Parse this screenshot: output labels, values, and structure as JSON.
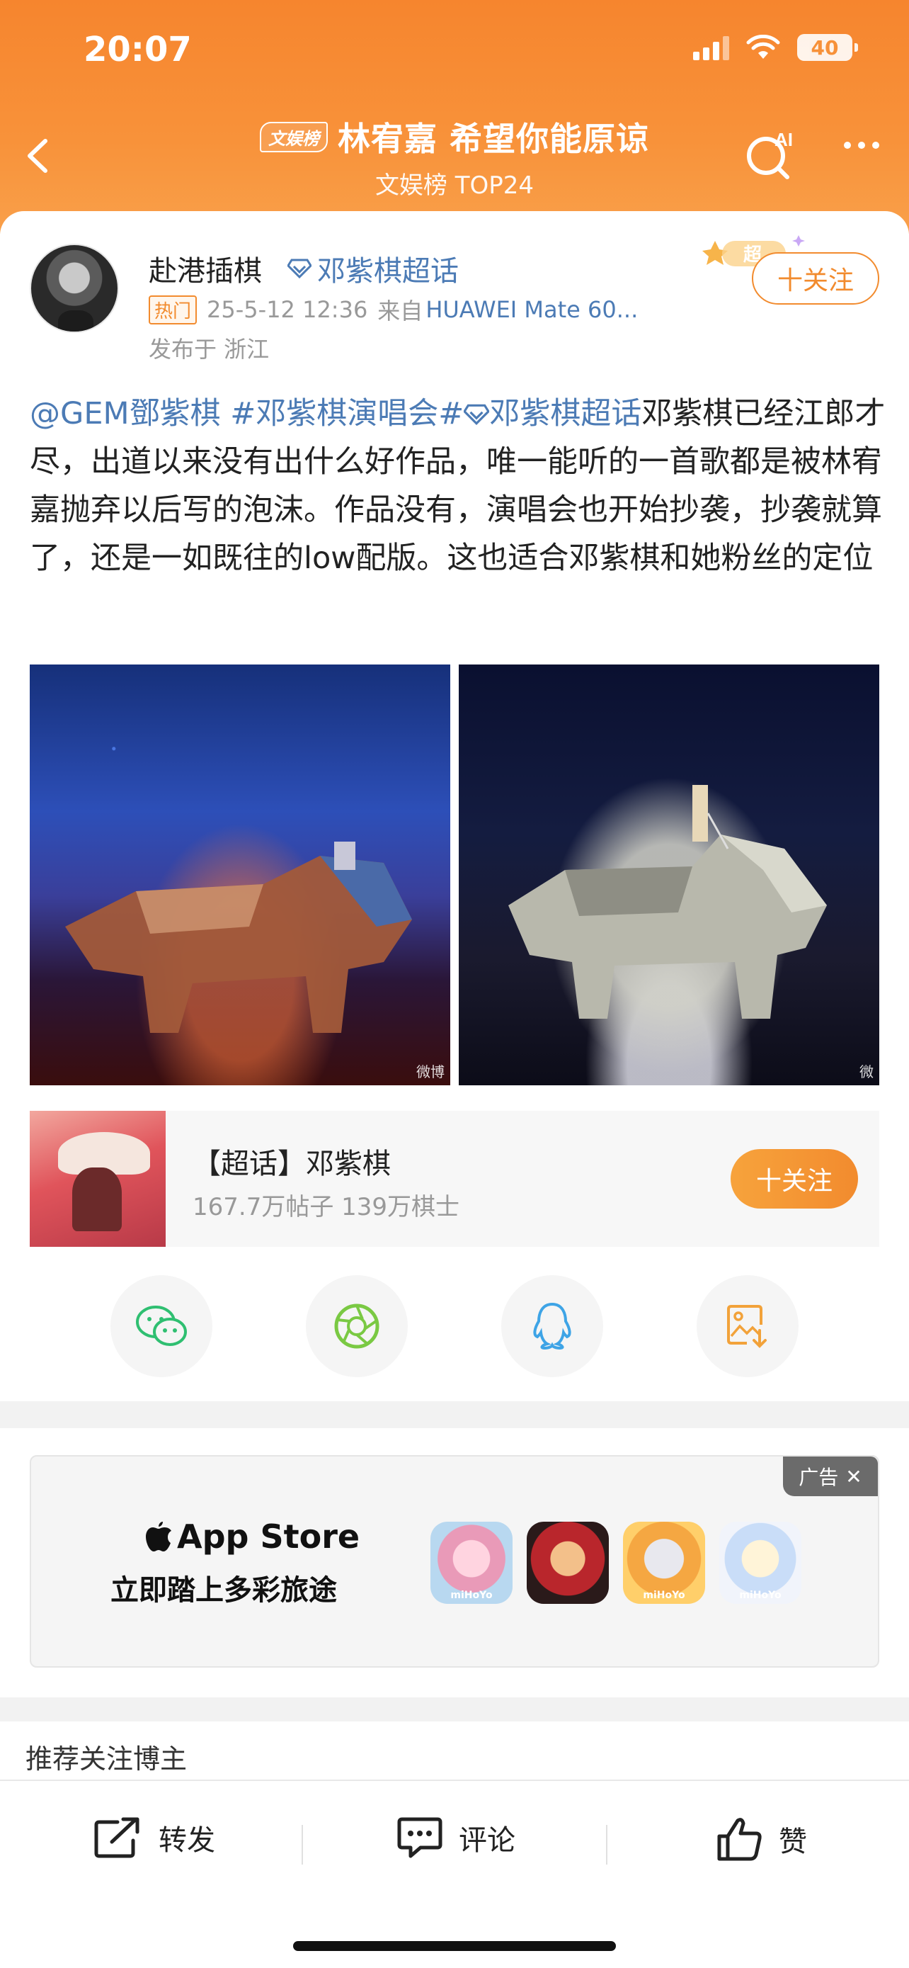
{
  "status": {
    "time": "20:07",
    "battery": "40"
  },
  "header": {
    "tag": "文娱榜",
    "title": "林宥嘉 希望你能原谅",
    "subtitle": "文娱榜 TOP24",
    "ai_label": "AI"
  },
  "post": {
    "username": "赴港插棋",
    "super_topic_link": "邓紫棋超话",
    "hot_badge": "热门",
    "datetime": "25-5-12 12:36",
    "source_prefix": "来自",
    "device": "HUAWEI Mate 60...",
    "location": "发布于 浙江",
    "follow_label": "十关注",
    "deco_label": "超",
    "text_mention": "@GEM鄧紫棋",
    "text_tag1": "#邓紫棋演唱会#",
    "text_tag2": "邓紫棋超话",
    "text_body": "邓紫棋已经江郎才尽，出道以来没有出什么好作品，唯一能听的一首歌都是被林宥嘉抛弃以后写的泡沫。作品没有，演唱会也开始抄袭，抄袭就算了，还是一如既往的low配版。这也适合邓紫棋和她粉丝的定位",
    "photo1_watermark": "微博",
    "photo2_watermark": "微"
  },
  "topic_card": {
    "name": "【超话】邓紫棋",
    "stats": "167.7万帖子 139万棋士",
    "follow_label": "十关注"
  },
  "share": [
    "wechat-icon",
    "moments-icon",
    "qq-icon",
    "save-image-icon"
  ],
  "ad": {
    "badge": "广告",
    "store": "App Store",
    "slogan": "立即踏上多彩旅途",
    "icon_brand": "miHoYo"
  },
  "recommend": {
    "title": "推荐关注博主"
  },
  "bottom": {
    "repost": "转发",
    "comment": "评论",
    "like": "赞"
  }
}
